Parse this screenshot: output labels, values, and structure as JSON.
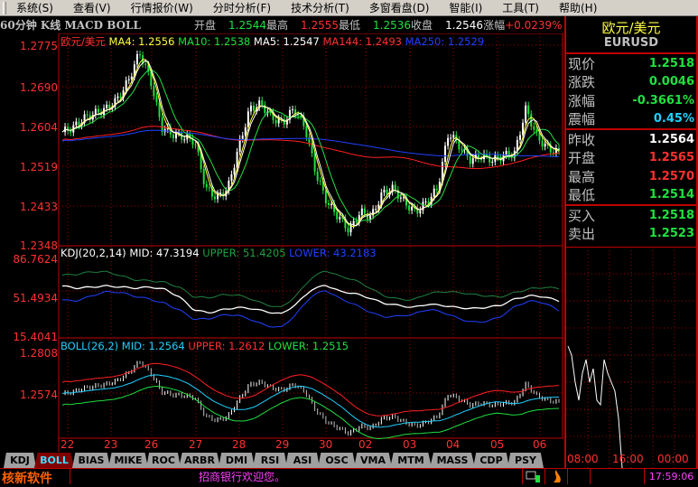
{
  "menu": [
    "系统(S)",
    "查看(V)",
    "行情报价(W)",
    "分时分析(F)",
    "技术分析(T)",
    "多窗看盘(D)",
    "智能(I)",
    "工具(T)",
    "帮助(H)"
  ],
  "header": {
    "title": "60分钟 K线 MACD BOLL",
    "open_label": "开盘",
    "open": "1.2544",
    "high_label": "最高",
    "high": "1.2555",
    "low_label": "最低",
    "low": "1.2536",
    "close_label": "收盘",
    "close": "1.2546",
    "change_label": "涨幅",
    "change": "+0.0239%"
  },
  "main_chart": {
    "name": "欧元/美元",
    "ma4": "MA4: 1.2556",
    "ma10": "MA10: 1.2538",
    "ma5": "MA5: 1.2547",
    "ma144": "MA144: 1.2493",
    "ma250": "MA250: 1.2529",
    "y_labels": [
      "1.2775",
      "1.2690",
      "1.2604",
      "1.2519",
      "1.2433",
      "1.2348"
    ]
  },
  "kdj": {
    "title": "KDJ(20,2,14)",
    "mid": "MID: 47.3194",
    "upper": "UPPER: 51.4205",
    "lower": "LOWER: 43.2183",
    "y_labels": [
      "86.7624",
      "51.4934",
      "15.4041"
    ]
  },
  "boll": {
    "title": "BOLL(26,2)",
    "mid": "MID: 1.2564",
    "upper": "UPPER: 1.2612",
    "lower": "LOWER: 1.2515",
    "y_labels": [
      "1.2808",
      "1.2574"
    ]
  },
  "dates": [
    "22",
    "23",
    "26",
    "27",
    "28",
    "29",
    "30",
    "02",
    "03",
    "04",
    "05",
    "06"
  ],
  "tabs": [
    "KDJ",
    "BOLL",
    "BIAS",
    "MIKE",
    "ROC",
    "ARBR",
    "DMI",
    "RSI",
    "ASI",
    "OSC",
    "VMA",
    "MTM",
    "MASS",
    "CDP",
    "PSY"
  ],
  "active_tab": "BOLL",
  "quote": {
    "name": "欧元/美元",
    "code": "EURUSD",
    "rows": [
      {
        "k": "现价",
        "v": "1.2518",
        "c": "#20e040"
      },
      {
        "k": "涨跌",
        "v": "0.0046",
        "c": "#20e040"
      },
      {
        "k": "涨幅",
        "v": "-0.3661%",
        "c": "#20e040"
      },
      {
        "k": "震幅",
        "v": "0.45%",
        "c": "#20d0ff"
      },
      {
        "k": "昨收",
        "v": "1.2564",
        "c": "#ffffff"
      },
      {
        "k": "开盘",
        "v": "1.2565",
        "c": "#ff3030"
      },
      {
        "k": "最高",
        "v": "1.2570",
        "c": "#ff3030"
      },
      {
        "k": "最低",
        "v": "1.2514",
        "c": "#20e040"
      },
      {
        "k": "买入",
        "v": "1.2518",
        "c": "#20e040"
      },
      {
        "k": "卖出",
        "v": "1.2523",
        "c": "#20e040"
      }
    ]
  },
  "mini_times": [
    "08:00",
    "16:00",
    "00:00"
  ],
  "status": {
    "logo": "核新软件",
    "message": "招商银行欢迎您。",
    "clock": "17:59:06"
  },
  "chart_data": {
    "type": "candlestick",
    "price_closes": [
      1.259,
      1.26,
      1.262,
      1.263,
      1.264,
      1.266,
      1.27,
      1.276,
      1.27,
      1.26,
      1.2585,
      1.258,
      1.257,
      1.247,
      1.245,
      1.247,
      1.256,
      1.264,
      1.265,
      1.262,
      1.261,
      1.264,
      1.26,
      1.25,
      1.244,
      1.241,
      1.238,
      1.242,
      1.241,
      1.246,
      1.247,
      1.244,
      1.242,
      1.244,
      1.247,
      1.259,
      1.256,
      1.253,
      1.254,
      1.253,
      1.254,
      1.2545,
      1.264,
      1.258,
      1.2555,
      1.2546
    ],
    "kdj_mid": [
      62,
      60,
      61,
      62,
      61,
      60,
      61,
      59,
      52,
      40,
      37,
      40,
      42,
      41,
      38,
      36,
      45,
      58,
      63,
      57,
      55,
      51,
      46,
      44,
      42,
      45,
      44,
      42,
      41,
      42,
      44,
      50,
      53,
      52,
      48
    ],
    "price_ylim": [
      1.2348,
      1.2775
    ]
  }
}
